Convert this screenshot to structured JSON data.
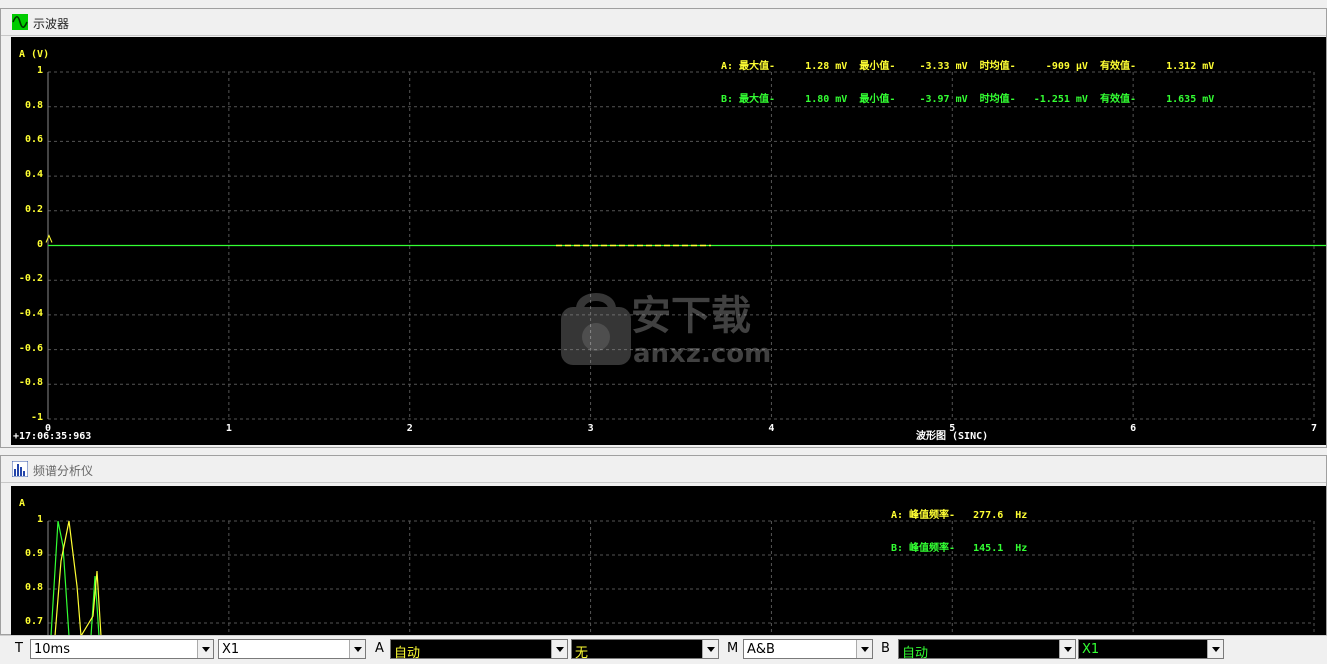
{
  "oscilloscope": {
    "title": "示波器",
    "y_axis_label": "A (V)",
    "y_ticks": [
      "1",
      "0.8",
      "0.6",
      "0.4",
      "0.2",
      "0",
      "-0.2",
      "-0.4",
      "-0.6",
      "-0.8",
      "-1"
    ],
    "x_ticks": [
      "0",
      "1",
      "2",
      "3",
      "4",
      "5",
      "6",
      "7"
    ],
    "timestamp": "+17:06:35:963",
    "x_title": "波形图 (SINC)",
    "stats": {
      "line_a": "A: 最大值-     1.28 mV  最小值-    -3.33 mV  时均值-     -909 μV  有效值-     1.312 mV",
      "line_b": "B: 最大值-     1.80 mV  最小值-    -3.97 mV  时均值-   -1.251 mV  有效值-     1.635 mV"
    }
  },
  "spectrum": {
    "title": "频谱分析仪",
    "y_axis_label": "A",
    "y_ticks": [
      "1",
      "0.9",
      "0.8",
      "0.7"
    ],
    "stats": {
      "line_a": "A: 峰值频率-   277.6  Hz",
      "line_b": "B: 峰值频率-   145.1  Hz"
    }
  },
  "toolbar": {
    "t_label": "T",
    "timebase": "10ms",
    "t_gain": "X1",
    "a_label": "A",
    "a_mode": "自动",
    "a_coupling": "无",
    "m_label": "M",
    "m_mode": "A&B",
    "b_label": "B",
    "b_mode": "自动",
    "b_gain": "X1"
  },
  "watermark": {
    "text": "安下载",
    "sub": "anxz.com"
  },
  "colors": {
    "channel_a": "#ffff33",
    "channel_b": "#33ff33",
    "grid": "#555555",
    "background": "#000000"
  }
}
